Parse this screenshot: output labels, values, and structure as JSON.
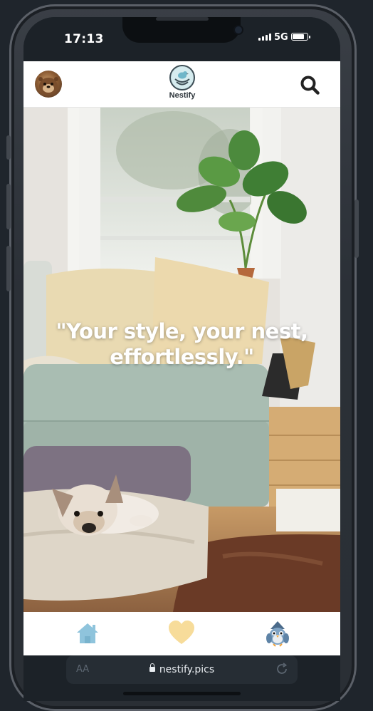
{
  "status": {
    "time": "17:13",
    "network": "5G",
    "battery_level": 0.85
  },
  "header": {
    "avatar_icon": "otter-avatar",
    "brand_name": "Nestify",
    "search_icon": "search-icon"
  },
  "hero": {
    "quote_line1": "\"Your style, your nest,",
    "quote_line2": "effortlessly.\""
  },
  "bottom_nav": {
    "items": [
      {
        "icon": "home-icon",
        "color": "#8fc4dc"
      },
      {
        "icon": "heart-icon",
        "color": "#f7dc9a"
      },
      {
        "icon": "bird-mascot-icon"
      }
    ]
  },
  "browser": {
    "text_size_label": "AA",
    "url": "nestify.pics"
  },
  "colors": {
    "accent_blue": "#8fc4dc",
    "accent_yellow": "#f7dc9a",
    "frame_dark": "#1c2228"
  }
}
